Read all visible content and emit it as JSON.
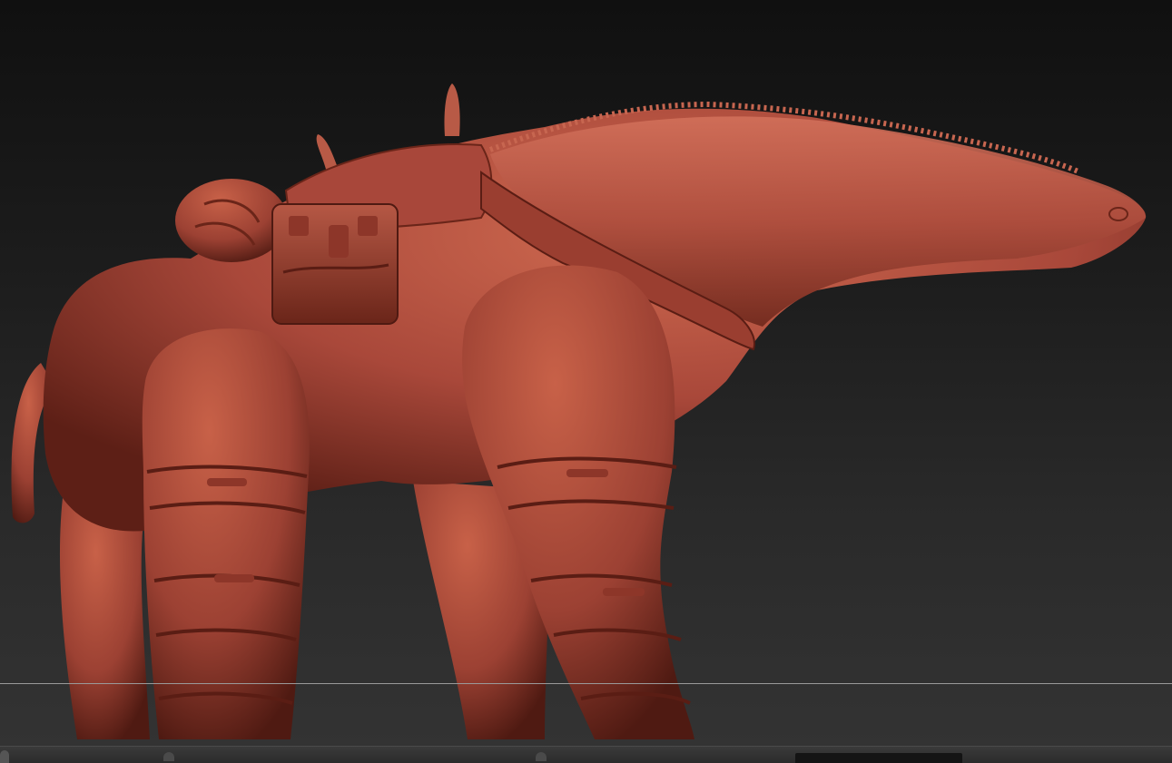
{
  "app": {
    "view": "3d-sculpt-viewport"
  },
  "scene": {
    "model": "creature-sculpt",
    "material_color": "#b0503a",
    "floor_grid": true
  },
  "colors": {
    "bg_top": "#101010",
    "bg_bottom": "#333333",
    "floor_line": "#9a9a9a",
    "clay": "#a9483a",
    "clay_dark": "#6a2519",
    "clay_light": "#d06a52"
  },
  "icons": {
    "bottom_left": "tray-handle-icon",
    "bottom_slider": "timeline-slider"
  }
}
